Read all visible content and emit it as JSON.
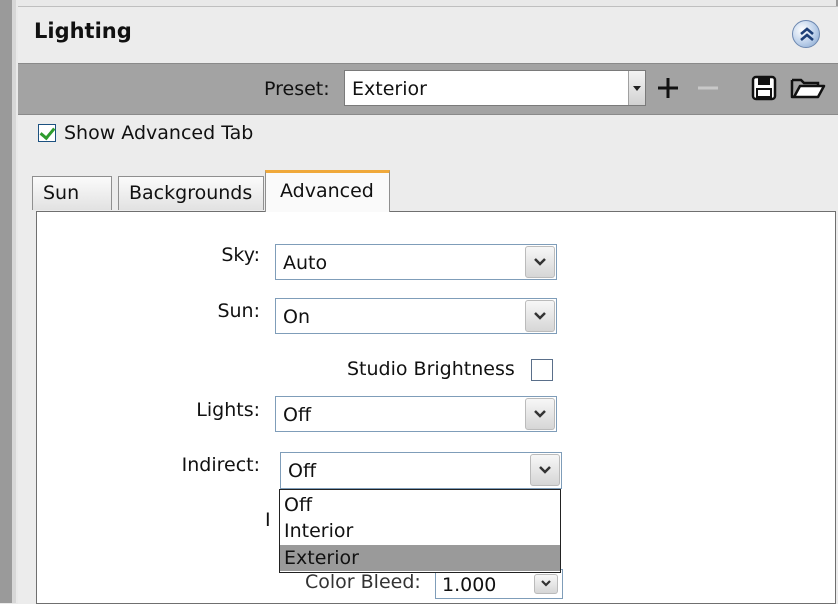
{
  "panel": {
    "title": "Lighting",
    "collapse_icon": "chevron-double-up-icon"
  },
  "preset": {
    "label": "Preset:",
    "value": "Exterior",
    "tools": [
      "add-icon",
      "remove-icon",
      "save-icon",
      "open-folder-icon"
    ]
  },
  "show_advanced": {
    "label": "Show Advanced Tab",
    "checked": true
  },
  "tabs": [
    {
      "label": "Sun",
      "active": false
    },
    {
      "label": "Backgrounds",
      "active": false
    },
    {
      "label": "Advanced",
      "active": true
    }
  ],
  "advanced": {
    "sky": {
      "label": "Sky:",
      "value": "Auto"
    },
    "sun": {
      "label": "Sun:",
      "value": "On"
    },
    "studio_brightness": {
      "label": "Studio Brightness",
      "checked": false
    },
    "lights": {
      "label": "Lights:",
      "value": "Off"
    },
    "indirect": {
      "label": "Indirect:",
      "value": "Off",
      "options": [
        "Off",
        "Interior",
        "Exterior"
      ],
      "highlighted": "Exterior"
    },
    "partial_label_fragment": "I",
    "color_bleed": {
      "label": "Color Bleed:",
      "value": "1.000"
    }
  },
  "colors": {
    "preset_bar": "#a3a3a3",
    "active_tab_accent": "#f0a93b",
    "checkmark": "#2e9b2e",
    "dropdown_highlight": "#9a9a9a"
  }
}
